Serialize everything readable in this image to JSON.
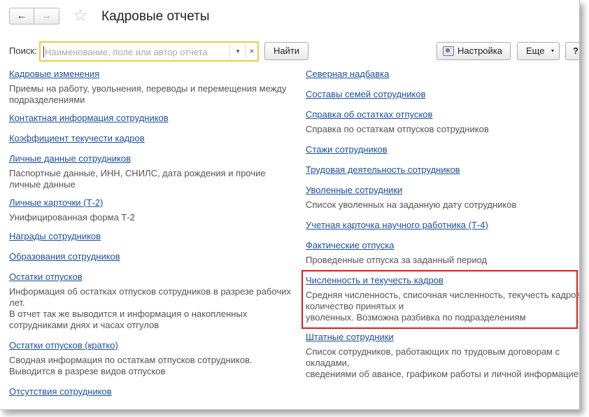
{
  "header": {
    "title": "Кадровые отчеты",
    "back_icon": "←",
    "forward_icon": "→",
    "favorite_icon": "☆"
  },
  "search": {
    "label": "Поиск:",
    "placeholder": "Наименование, поле или автор отчета",
    "value": "",
    "dropdown_icon": "▾",
    "clear_icon": "×"
  },
  "toolbar": {
    "find_label": "Найти",
    "settings_label": "Настройка",
    "more_label": "Еще",
    "more_arrow": "▾",
    "help_label": "?"
  },
  "left_reports": [
    {
      "title": "Кадровые изменения",
      "description": "Приемы на работу, увольнения, переводы и перемещения между подразделениями"
    },
    {
      "title": "Контактная информация сотрудников",
      "description": ""
    },
    {
      "title": "Коэффициент текучести кадров",
      "description": ""
    },
    {
      "title": "Личные данные сотрудников",
      "description": "Паспортные данные, ИНН, СНИЛС, дата рождения и прочие личные данные"
    },
    {
      "title": "Личные карточки (Т-2)",
      "description": "Унифицированная форма Т-2"
    },
    {
      "title": "Награды сотрудников",
      "description": ""
    },
    {
      "title": "Образования сотрудников",
      "description": ""
    },
    {
      "title": "Остатки отпусков",
      "description": "Информация об остатках отпусков сотрудников в разрезе рабочих лет.\nВ отчет так же выводится и информация о накопленных сотрудниками днях и часах отгулов"
    },
    {
      "title": "Остатки отпусков (кратко)",
      "description": "Сводная информация по остаткам отпусков сотрудников.\nВыводится в разрезе видов отпусков"
    },
    {
      "title": "Отсутствия сотрудников",
      "description": ""
    }
  ],
  "right_reports": [
    {
      "title": "Северная надбавка",
      "description": ""
    },
    {
      "title": "Составы семей сотрудников",
      "description": ""
    },
    {
      "title": "Справка об остатках отпусков",
      "description": "Справка по остаткам отпусков сотрудников"
    },
    {
      "title": "Стажи сотрудников",
      "description": ""
    },
    {
      "title": "Трудовая деятельность сотрудников",
      "description": ""
    },
    {
      "title": "Уволенные сотрудники",
      "description": "Список уволенных на заданную дату сотрудников"
    },
    {
      "title": "Учетная карточка научного работника (Т-4)",
      "description": ""
    },
    {
      "title": "Фактические отпуска",
      "description": "Проведенные отпуска за заданный период"
    },
    {
      "title": "Численность и текучесть кадров",
      "description": "Средняя численность, списочная численность, текучесть кадров, количество принятых и\nуволенных. Возможна разбивка по подразделениям"
    },
    {
      "title": "Штатные сотрудники",
      "description": "Список сотрудников, работающих по трудовым договорам с окладами,\nсведениями об авансе, графиком работы и личной информацией"
    }
  ],
  "colors": {
    "link": "#1c4f9c",
    "description_text": "#545454",
    "search_focus_border": "#f0c94a",
    "highlight_border": "#e01b1b"
  }
}
